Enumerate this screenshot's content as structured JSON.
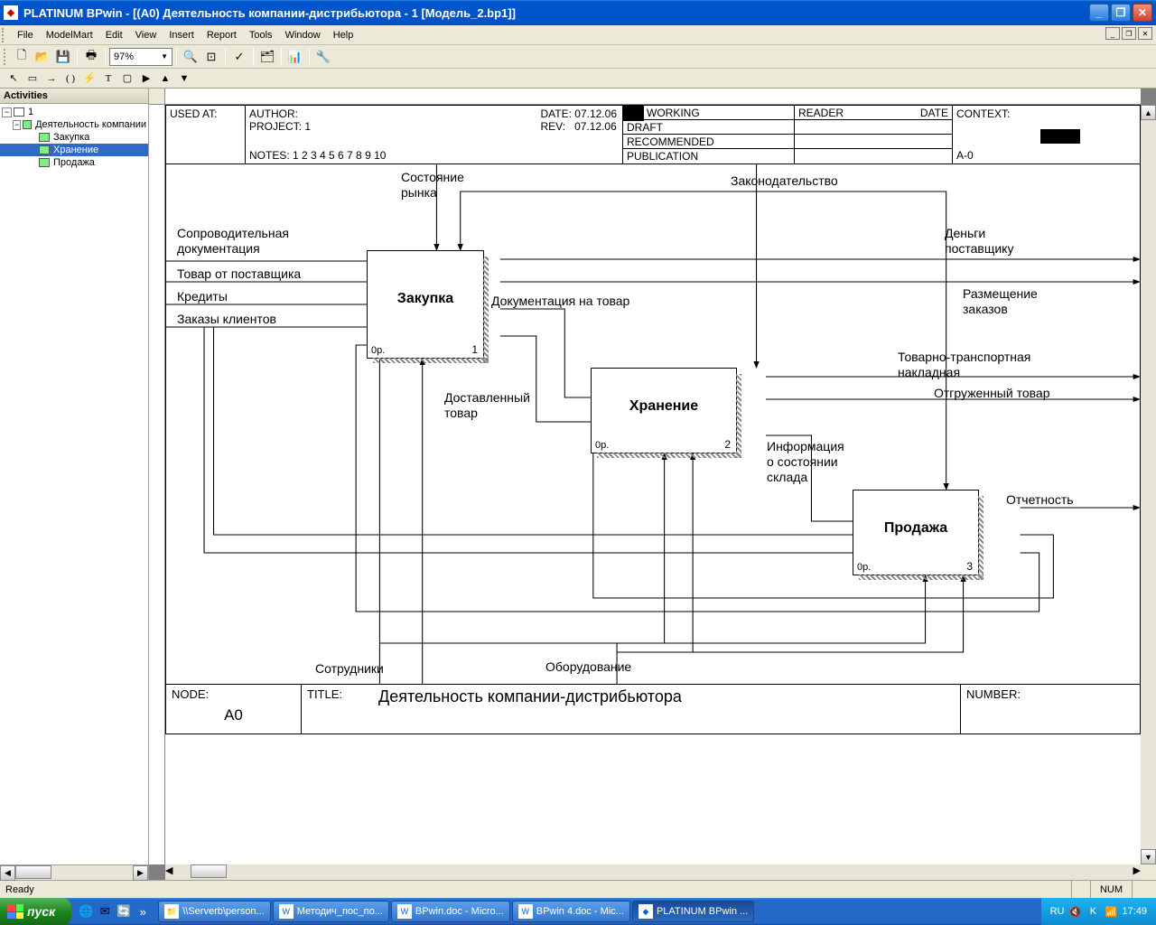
{
  "window": {
    "title": "PLATINUM BPwin - [(A0) Деятельность  компании-дистрибьютора - 1  [Модель_2.bp1]]"
  },
  "menu": {
    "file": "File",
    "modelmart": "ModelMart",
    "edit": "Edit",
    "view": "View",
    "insert": "Insert",
    "report": "Report",
    "tools": "Tools",
    "window": "Window",
    "help": "Help"
  },
  "toolbar": {
    "zoom": "97%"
  },
  "sidebar": {
    "title": "Activities",
    "items": [
      {
        "label": "1",
        "level": 1,
        "root": true
      },
      {
        "label": "Деятельность компании",
        "level": 2
      },
      {
        "label": "Закупка",
        "level": 3
      },
      {
        "label": "Хранение",
        "level": 3,
        "selected": true
      },
      {
        "label": "Продажа",
        "level": 3
      }
    ]
  },
  "header": {
    "used_at": "USED AT:",
    "author": "AUTHOR:",
    "project": "PROJECT:  1",
    "notes": "NOTES:  1  2  3  4  5  6  7  8  9  10",
    "date_lbl": "DATE:",
    "date": "07.12.06",
    "rev_lbl": "REV:",
    "rev": "07.12.06",
    "working": "WORKING",
    "draft": "DRAFT",
    "recommended": "RECOMMENDED",
    "publication": "PUBLICATION",
    "reader": "READER",
    "date2": "DATE",
    "context": "CONTEXT:",
    "context_val": "A-0"
  },
  "activities": {
    "a1": {
      "name": "Закупка",
      "cost": "0р.",
      "num": "1"
    },
    "a2": {
      "name": "Хранение",
      "cost": "0р.",
      "num": "2"
    },
    "a3": {
      "name": "Продажа",
      "cost": "0р.",
      "num": "3"
    }
  },
  "labels": {
    "l1": "Сопроводительная\nдокументация",
    "l2": "Товар от поставщика",
    "l3": "Кредиты",
    "l4": "Заказы клиентов",
    "l5": "Состояние\nрынка",
    "l6": "Законодательство",
    "l7": "Деньги\nпоставщику",
    "l8": "Размещение\nзаказов",
    "l9": "Документация на товар",
    "l10": "Доставленный\nтовар",
    "l11": "Товарно-транспортная\nнакладная",
    "l12": "Отгруженный товар",
    "l13": "Информация\nо состоянии\nсклада",
    "l14": "Отчетность",
    "l15": "Сотрудники",
    "l16": "Оборудование"
  },
  "footer": {
    "node_lbl": "NODE:",
    "node": "A0",
    "title_lbl": "TITLE:",
    "title": "Деятельность  компании-дистрибьютора",
    "number_lbl": "NUMBER:"
  },
  "status": {
    "ready": "Ready",
    "num": "NUM"
  },
  "taskbar": {
    "start": "пуск",
    "tasks": [
      "\\\\Serverb\\person...",
      "Методич_пос_по...",
      "BPwin.doc - Micro...",
      "BPwin 4.doc - Mic...",
      "PLATINUM BPwin ..."
    ],
    "lang": "RU",
    "time": "17:49"
  }
}
